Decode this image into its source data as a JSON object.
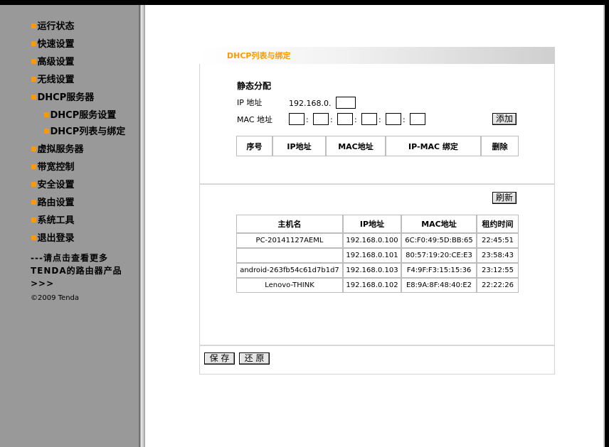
{
  "sidebar": {
    "items": [
      {
        "label": "运行状态",
        "level": 1
      },
      {
        "label": "快速设置",
        "level": 1
      },
      {
        "label": "高级设置",
        "level": 1
      },
      {
        "label": "无线设置",
        "level": 1
      },
      {
        "label": "DHCP服务器",
        "level": 1
      },
      {
        "label": "DHCP服务设置",
        "level": 2
      },
      {
        "label": "DHCP列表与绑定",
        "level": 2
      },
      {
        "label": "虚拟服务器",
        "level": 1
      },
      {
        "label": "带宽控制",
        "level": 1
      },
      {
        "label": "安全设置",
        "level": 1
      },
      {
        "label": "路由设置",
        "level": 1
      },
      {
        "label": "系统工具",
        "level": 1
      },
      {
        "label": "退出登录",
        "level": 1
      }
    ],
    "more_link": "---请点击查看更多TENDA的路由器产品>>>",
    "copyright": "©2009 Tenda"
  },
  "page": {
    "title": "DHCP列表与绑定",
    "static_section_title": "静态分配",
    "ip_label": "IP 地址",
    "ip_prefix": "192.168.0.",
    "ip_last_value": "",
    "mac_label": "MAC 地址",
    "mac_parts": [
      "",
      "",
      "",
      "",
      "",
      ""
    ],
    "add_button": "添加",
    "static_table_headers": [
      "序号",
      "IP地址",
      "MAC地址",
      "IP-MAC 绑定",
      "删除"
    ],
    "refresh_button": "刷新",
    "lease_table_headers": [
      "主机名",
      "IP地址",
      "MAC地址",
      "租约时间"
    ],
    "lease_rows": [
      [
        "PC-20141127AEML",
        "192.168.0.100",
        "6C:F0:49:5D:BB:65",
        "22:45:51"
      ],
      [
        "",
        "192.168.0.101",
        "80:57:19:20:CE:E3",
        "23:58:43"
      ],
      [
        "android-263fb54c61d7b1d7",
        "192.168.0.103",
        "F4:9F:F3:15:15:36",
        "23:12:55"
      ],
      [
        "Lenovo-THINK",
        "192.168.0.102",
        "E8:9A:8F:48:40:E2",
        "22:22:26"
      ]
    ],
    "save_button": "保 存",
    "restore_button": "还 原"
  },
  "colors": {
    "sidebar_bg": "#999999",
    "bullet": "#ff9900",
    "title": "#ff9900",
    "main_bg": "#ffffff"
  }
}
